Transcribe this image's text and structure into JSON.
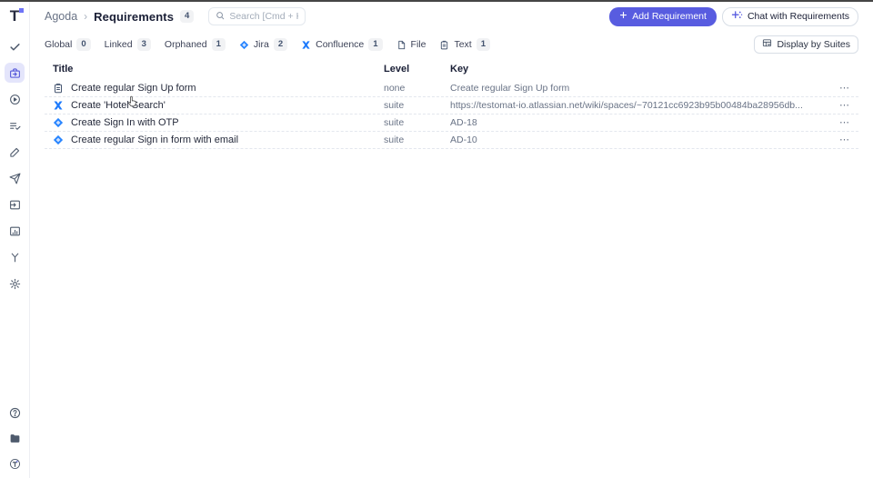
{
  "header": {
    "breadcrumb": {
      "project": "Agoda",
      "separator": "›",
      "page": "Requirements",
      "count": "4"
    },
    "search_placeholder": "Search [Cmd + K]",
    "add_requirement_label": "Add Requirement",
    "chat_label": "Chat with Requirements"
  },
  "filter_bar": {
    "tabs": [
      {
        "label": "Global",
        "count": "0",
        "icon": null
      },
      {
        "label": "Linked",
        "count": "3",
        "icon": null
      },
      {
        "label": "Orphaned",
        "count": "1",
        "icon": null
      },
      {
        "label": "Jira",
        "count": "2",
        "icon": "jira"
      },
      {
        "label": "Confluence",
        "count": "1",
        "icon": "confluence"
      },
      {
        "label": "File",
        "count": null,
        "icon": "file"
      },
      {
        "label": "Text",
        "count": "1",
        "icon": "text"
      }
    ],
    "display_by_suites_label": "Display by Suites"
  },
  "table": {
    "columns": {
      "title": "Title",
      "level": "Level",
      "key": "Key"
    },
    "rows": [
      {
        "icon": "text",
        "title": "Create regular Sign Up form",
        "level": "none",
        "key": "Create regular Sign Up form"
      },
      {
        "icon": "confluence",
        "title": "Create 'Hotel Search'",
        "level": "suite",
        "key": "https://testomat-io.atlassian.net/wiki/spaces/~70121cc6923b95b00484ba28956db..."
      },
      {
        "icon": "jira",
        "title": "Create Sign In with OTP",
        "level": "suite",
        "key": "AD-18"
      },
      {
        "icon": "jira",
        "title": "Create regular Sign in form with email",
        "level": "suite",
        "key": "AD-10"
      }
    ],
    "row_menu_glyph": "⋯"
  },
  "sidebar": {
    "logo_letter": "T",
    "items": [
      {
        "icon": "check",
        "active": false
      },
      {
        "icon": "requirements",
        "active": true
      },
      {
        "icon": "runs",
        "active": false
      },
      {
        "icon": "checklist",
        "active": false
      },
      {
        "icon": "pencil",
        "active": false
      },
      {
        "icon": "send",
        "active": false
      },
      {
        "icon": "import",
        "active": false
      },
      {
        "icon": "report",
        "active": false
      },
      {
        "icon": "branch",
        "active": false
      },
      {
        "icon": "settings",
        "active": false
      }
    ],
    "bottom_items": [
      {
        "icon": "help"
      },
      {
        "icon": "folder"
      },
      {
        "icon": "profile"
      }
    ]
  },
  "colors": {
    "accent": "#585ce0",
    "accent_light": "#e4e5fb",
    "badge_bg": "#f1f2f4",
    "jira_blue": "#2684ff",
    "confluence_blue": "#1d7afc",
    "text_dark": "#1a1f36",
    "text_gray": "#697386"
  }
}
